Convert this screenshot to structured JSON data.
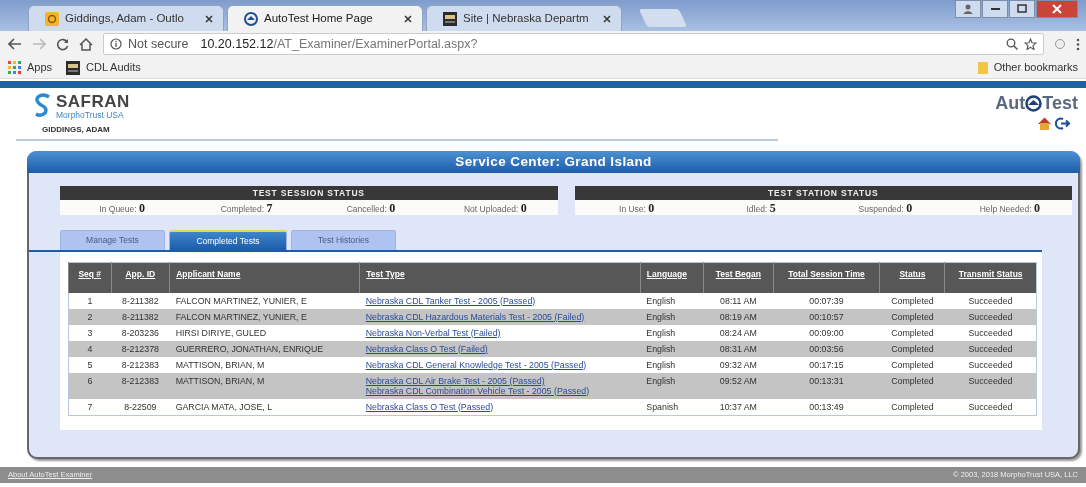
{
  "browser": {
    "tabs": [
      {
        "label": "Giddings, Adam - Outlo",
        "selected": false
      },
      {
        "label": "AutoTest Home Page",
        "selected": true
      },
      {
        "label": "Site | Nebraska Departm",
        "selected": false
      }
    ],
    "security": "Not secure",
    "address_host": "10.20.152.12",
    "address_path": "/AT_Examiner/ExaminerPortal.aspx?",
    "bookmarks": [
      "Apps",
      "CDL Audits"
    ],
    "other_bookmarks": "Other bookmarks"
  },
  "header": {
    "brand": "SAFRAN",
    "sub_brand": "MorphoTrust USA",
    "user": "GIDDINGS, ADAM",
    "product_left": "Aut",
    "product_right": "Test"
  },
  "panel_title": "Service Center: Grand Island",
  "session_status": {
    "title": "TEST SESSION STATUS",
    "items": [
      {
        "label": "In Queue:",
        "value": "0"
      },
      {
        "label": "Completed:",
        "value": "7"
      },
      {
        "label": "Cancelled:",
        "value": "0"
      },
      {
        "label": "Not Uploaded:",
        "value": "0"
      }
    ]
  },
  "station_status": {
    "title": "TEST STATION STATUS",
    "items": [
      {
        "label": "In Use:",
        "value": "0"
      },
      {
        "label": "Idled:",
        "value": "5"
      },
      {
        "label": "Suspended:",
        "value": "0"
      },
      {
        "label": "Help Needed:",
        "value": "0"
      }
    ]
  },
  "tabs": [
    {
      "label": "Manage Tests",
      "selected": false
    },
    {
      "label": "Completed Tests",
      "selected": true
    },
    {
      "label": "Test Histories",
      "selected": false
    }
  ],
  "table": {
    "columns": [
      "Seq #",
      "App. ID",
      "Applicant Name",
      "Test Type",
      "Language",
      "Test Began",
      "Total Session Time",
      "Status",
      "Transmit Status"
    ],
    "rows": [
      {
        "seq": "1",
        "app_id": "8-211382",
        "name": "FALCON MARTINEZ, YUNIER, E",
        "tests": [
          "Nebraska CDL Tanker Test - 2005 (Passed)"
        ],
        "language": "English",
        "began": "08:11 AM",
        "total": "00:07:39",
        "status": "Completed",
        "transmit": "Succeeded"
      },
      {
        "seq": "2",
        "app_id": "8-211382",
        "name": "FALCON MARTINEZ, YUNIER, E",
        "tests": [
          "Nebraska CDL Hazardous Materials Test - 2005 (Failed)"
        ],
        "language": "English",
        "began": "08:19 AM",
        "total": "00:10:57",
        "status": "Completed",
        "transmit": "Succeeded"
      },
      {
        "seq": "3",
        "app_id": "8-203236",
        "name": "HIRSI DIRIYE, GULED",
        "tests": [
          "Nebraska Non-Verbal Test (Failed)"
        ],
        "language": "English",
        "began": "08:24 AM",
        "total": "00:09:00",
        "status": "Completed",
        "transmit": "Succeeded"
      },
      {
        "seq": "4",
        "app_id": "8-212378",
        "name": "GUERRERO, JONATHAN, ENRIQUE",
        "tests": [
          "Nebraska Class O Test (Failed)"
        ],
        "language": "English",
        "began": "08:31 AM",
        "total": "00:03:56",
        "status": "Completed",
        "transmit": "Succeeded"
      },
      {
        "seq": "5",
        "app_id": "8-212383",
        "name": "MATTISON, BRIAN, M",
        "tests": [
          "Nebraska CDL General Knowledge Test - 2005 (Passed)"
        ],
        "language": "English",
        "began": "09:32 AM",
        "total": "00:17:15",
        "status": "Completed",
        "transmit": "Succeeded"
      },
      {
        "seq": "6",
        "app_id": "8-212383",
        "name": "MATTISON, BRIAN, M",
        "tests": [
          "Nebraska CDL Air Brake Test - 2005 (Passed)",
          "Nebraska CDL Combination Vehicle Test - 2005 (Passed)"
        ],
        "language": "English",
        "began": "09:52 AM",
        "total": "00:13:31",
        "status": "Completed",
        "transmit": "Succeeded"
      },
      {
        "seq": "7",
        "app_id": "8-22509",
        "name": "GARCIA MATA, JOSE, L",
        "tests": [
          "Nebraska Class O Test (Passed)"
        ],
        "language": "Spanish",
        "began": "10:37 AM",
        "total": "00:13:49",
        "status": "Completed",
        "transmit": "Succeeded"
      }
    ]
  },
  "footer": {
    "link": "About AutoTest Examiner",
    "copyright": "© 2003, 2018 MorphoTrust USA, LLC"
  }
}
